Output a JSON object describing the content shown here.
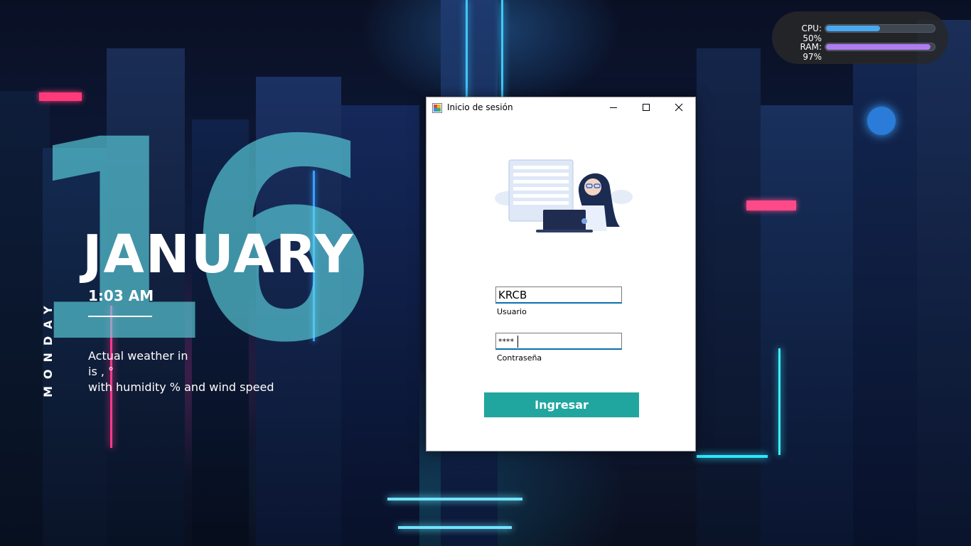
{
  "desktop": {
    "widget": {
      "day_number": "16",
      "month": "JANUARY",
      "time": "1:03 AM",
      "weekday": "MONDAY",
      "weather_line1": "Actual weather in",
      "weather_line2": "is , °",
      "weather_line3": "with humidity  % and wind speed"
    },
    "stats": {
      "cpu_label": "CPU: 50%",
      "cpu_percent": 50,
      "cpu_color": "#4aa8f0",
      "ram_label": "RAM: 97%",
      "ram_percent": 97,
      "ram_color": "#b07cf0"
    }
  },
  "window": {
    "title": "Inicio de sesión",
    "icons": {
      "app": "app-icon",
      "minimize": "minimize-icon",
      "maximize": "maximize-icon",
      "close": "close-icon"
    },
    "username": {
      "value": "KRCB",
      "label": "Usuario"
    },
    "password": {
      "value": "****",
      "label": "Contraseña"
    },
    "login_button": "Ingresar",
    "accent_color": "#21a69f"
  }
}
